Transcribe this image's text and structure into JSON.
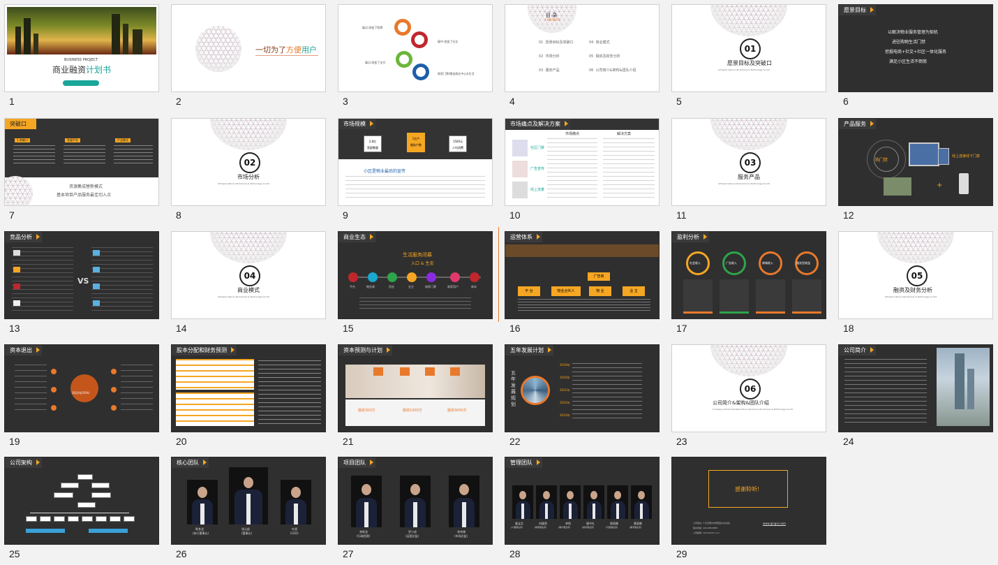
{
  "slides": [
    {
      "num": "1",
      "title_en": "BUSINESS PROJECT",
      "title_a": "商业融资",
      "title_b": "计划书"
    },
    {
      "num": "2",
      "slogan_a": "一切为了",
      "slogan_b": "方便",
      "slogan_c": "用户"
    },
    {
      "num": "3",
      "items": [
        "痛点:改变了购票",
        "痛中:改变了社交",
        "痛点:改变了支付",
        "商家门票/赠送商业中心&生活"
      ]
    },
    {
      "num": "4",
      "title": "目 录",
      "subtitle": "CONTENTS",
      "items": [
        [
          "01",
          "愿景目标及突破口"
        ],
        [
          "02",
          "市场分析"
        ],
        [
          "03",
          "服务产品"
        ],
        [
          "04",
          "商业模式"
        ],
        [
          "05",
          "融资及财务分析"
        ],
        [
          "06",
          "公司简介&架构&团队介绍"
        ]
      ]
    },
    {
      "num": "5",
      "circle": "01",
      "title": "愿景目标及突破口",
      "sub": "Schwarz nature Life Science & Technology Co.Ltd"
    },
    {
      "num": "6",
      "tag": "愿景目标",
      "lines": [
        "以解决物业服务管理为契机",
        "进驻购物生活门禁",
        "挖掘电商+社交+社区一体化服务",
        "满足小区生活不倒翁"
      ]
    },
    {
      "num": "7",
      "tag": "突破口",
      "cols": [
        "1.突破口",
        "发展平台",
        "产品模式"
      ],
      "caption_a": "资源集成替新模式",
      "caption_b": "基本项目产品服务最佳切入点"
    },
    {
      "num": "8",
      "circle": "02",
      "title": "市场分析",
      "sub": "Schwarz nature Life Science & Technology Co.Ltd"
    },
    {
      "num": "9",
      "tag": "市场规模",
      "stats": [
        [
          "2,8亿",
          "家庭数量"
        ],
        [
          "1亿户",
          "服务户数"
        ],
        [
          "1500元",
          "人均消费"
        ]
      ],
      "heading": "小区是物业最后的宣传"
    },
    {
      "num": "10",
      "tag": "市场痛点及解决方案",
      "h1": "市场痛点",
      "h2": "解决方案",
      "labels": [
        "社区门禁",
        "广告宣传",
        "线上流量"
      ]
    },
    {
      "num": "11",
      "circle": "03",
      "title": "服务产品",
      "sub": "Schwarz nature Life Science & Technology Co.Ltd"
    },
    {
      "num": "12",
      "tag": "产品服务",
      "left": "购门禁",
      "right": "线上连接线下门禁"
    },
    {
      "num": "13",
      "tag": "竞品分析",
      "vs": "VS"
    },
    {
      "num": "14",
      "circle": "04",
      "title": "商业模式",
      "sub": "Schwarz nature Life Science & Technology Co.Ltd"
    },
    {
      "num": "15",
      "tag": "商业生态",
      "center": "生活服务闭幕",
      "entry": "入口 & 生态",
      "nodes": [
        "平台",
        "物业商",
        "用业",
        "业主",
        "商家门票",
        "商家用户",
        "商本"
      ]
    },
    {
      "num": "16",
      "tag": "运营体系",
      "flow": [
        "平 台",
        "物业合伙人",
        "物 业",
        "业 主"
      ],
      "top": "广告商"
    },
    {
      "num": "17",
      "tag": "盈利分析",
      "rings": [
        "社会收入",
        "广告收入",
        "商城收入",
        "服务型收益"
      ]
    },
    {
      "num": "18",
      "circle": "05",
      "title": "融资及财务分析",
      "sub": "Schwarz nature Life Science & Technology Co.Ltd"
    },
    {
      "num": "19",
      "tag": "资本退出",
      "center": "30天内(20%)"
    },
    {
      "num": "20",
      "tag": "股本分配和财务预测"
    },
    {
      "num": "21",
      "tag": "资本预测与计划",
      "prices": [
        "融资300万",
        "融资1000万",
        "融资3000万"
      ]
    },
    {
      "num": "22",
      "tag": "五年发展计划",
      "vertical": "五年发展规划",
      "years": [
        "2019年:",
        "2020年:",
        "2021年:",
        "2022年:",
        "2023年:"
      ]
    },
    {
      "num": "23",
      "circle": "06",
      "title": "公司简介&架构&团队介绍",
      "sub": "Company introduction&structure introduce Life Science & Technology Co.Ltd"
    },
    {
      "num": "24",
      "tag": "公司简介"
    },
    {
      "num": "25",
      "tag": "公司架构"
    },
    {
      "num": "26",
      "tag": "核心团队",
      "members": [
        [
          "陈其龙",
          "(执行董事长)"
        ],
        [
          "张沁彪",
          "(董事长)"
        ],
        [
          "叶斌",
          "(CEO)"
        ]
      ]
    },
    {
      "num": "27",
      "tag": "项目团队",
      "members": [
        [
          "李昭龙",
          "(行政经理)"
        ],
        [
          "罗小虎",
          "(运营总监)"
        ],
        [
          "李伟博",
          "(市场总监)"
        ]
      ]
    },
    {
      "num": "28",
      "tag": "管理团队",
      "members": [
        [
          "姜宝兵",
          "(人事部主管)"
        ],
        [
          "刘顺然",
          "(财务部主管)"
        ],
        [
          "李悦",
          "(客户部主管)"
        ],
        [
          "唐书礼",
          "(技术部主管)"
        ],
        [
          "顾丽娜",
          "(行政部主管)"
        ],
        [
          "黄丽娜",
          "(美术部主管)"
        ]
      ]
    },
    {
      "num": "29",
      "thanks": "感谢聆听!",
      "website": "www.qingni.com",
      "contact": [
        "公司地址:",
        "广东省惠州市惠阳区淡水某某",
        "联系电话:",
        "400-888-8888",
        "公司邮箱:",
        "2021@163.com"
      ]
    }
  ],
  "colors": {
    "accent": "#f5a623",
    "dark": "#2f2f2f",
    "teal": "#1aa79a",
    "orange": "#e8792b"
  }
}
